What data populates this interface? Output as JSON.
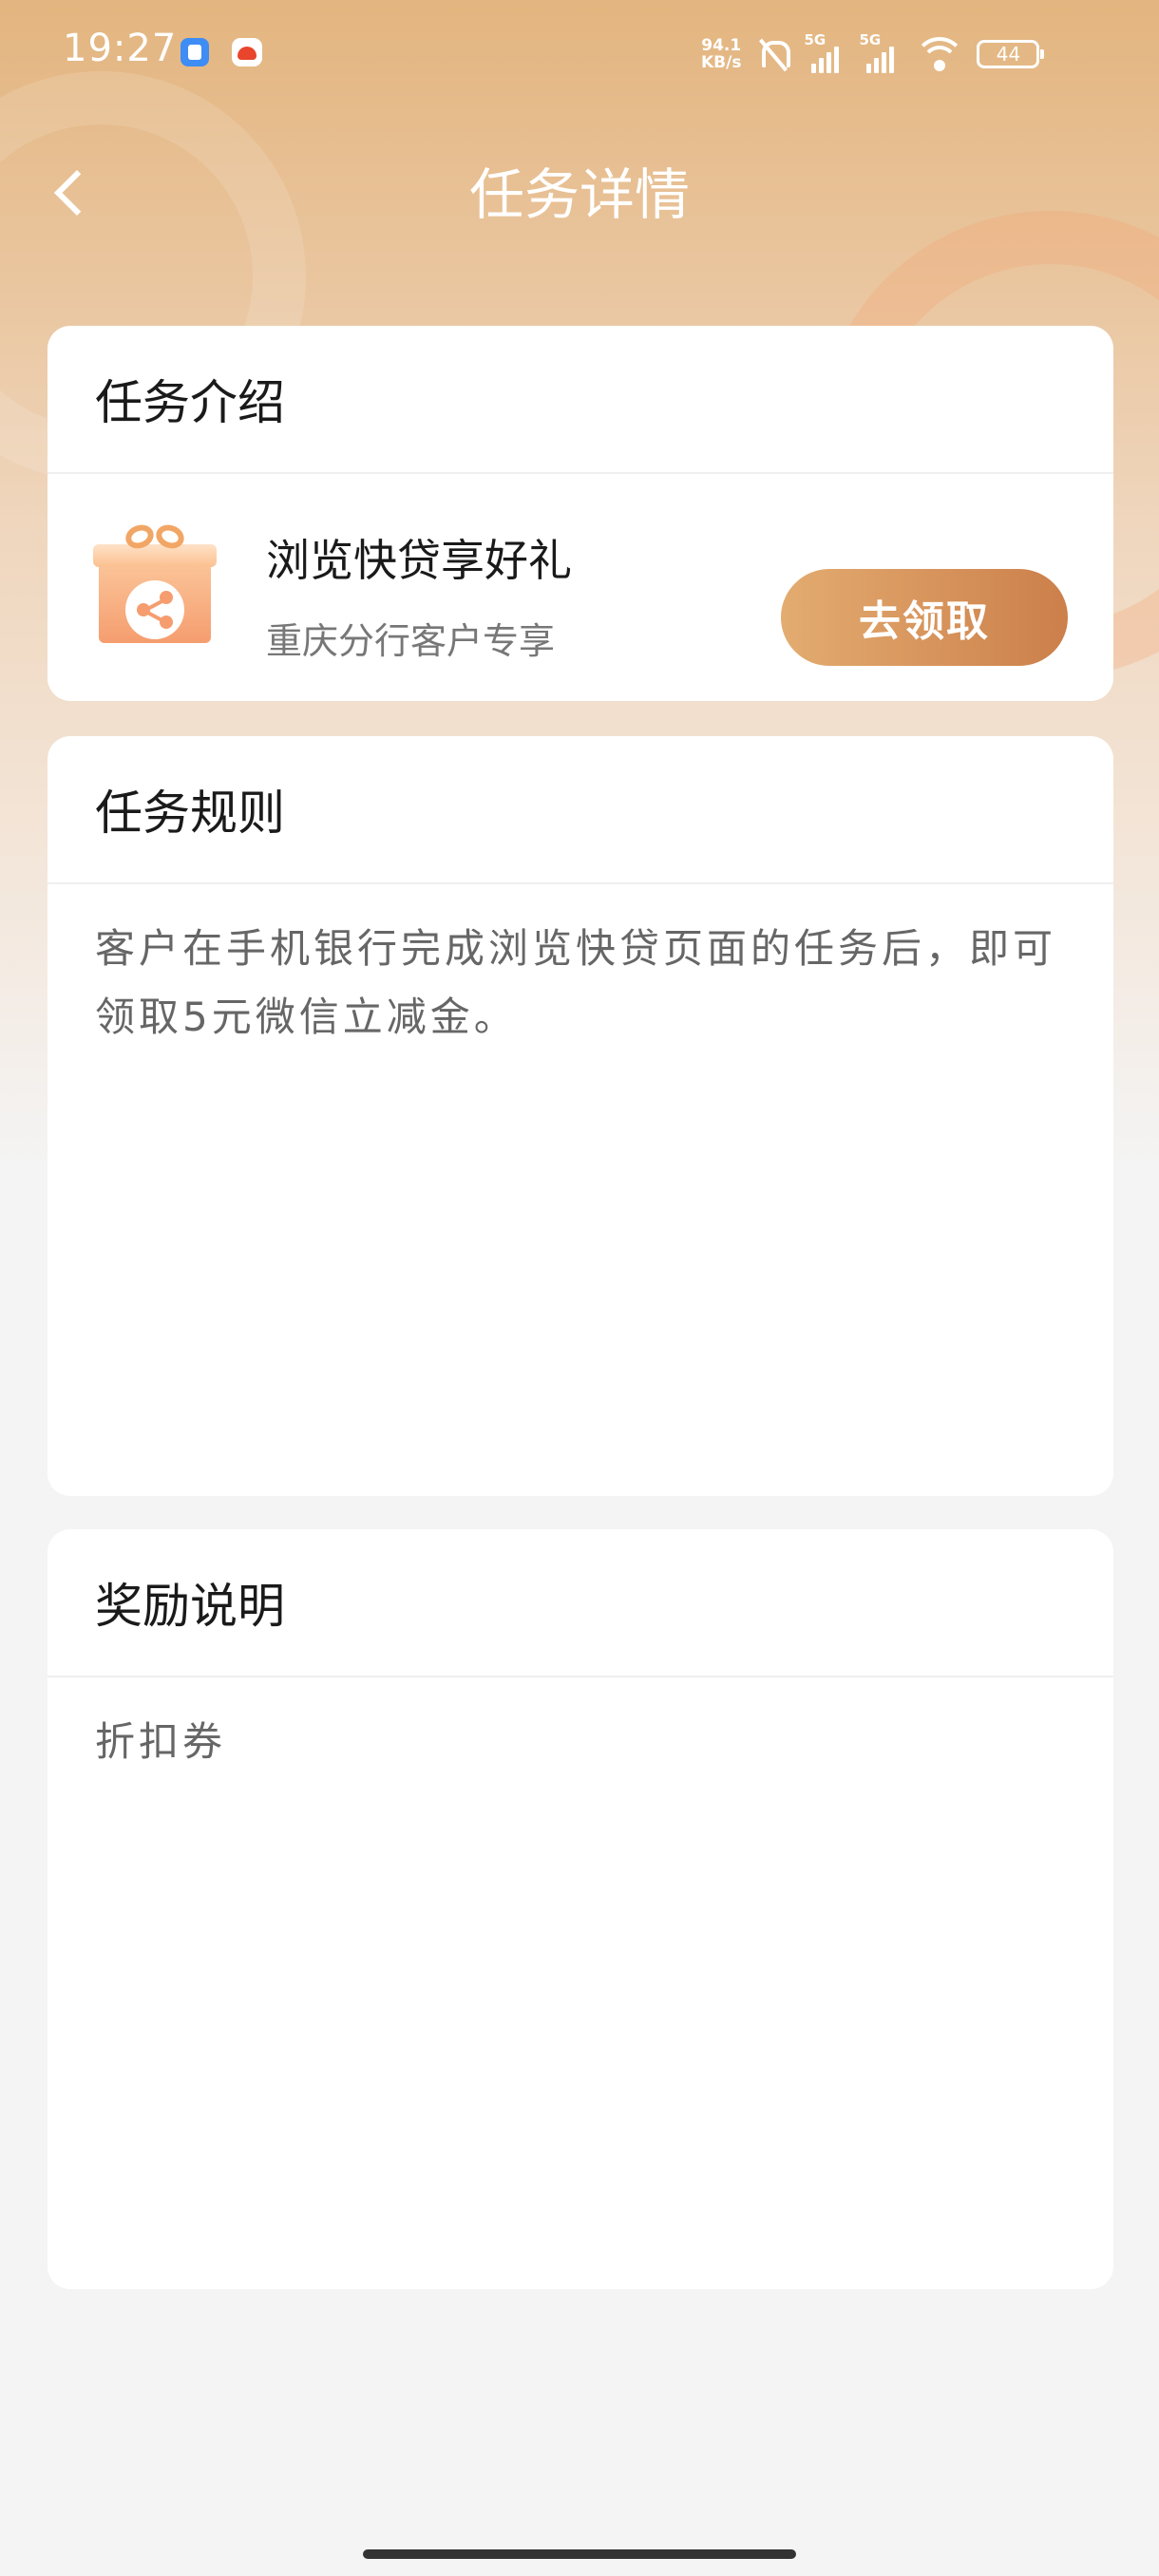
{
  "status_bar": {
    "time": "19:27",
    "net_speed_value": "94.1",
    "net_speed_unit": "KB/s",
    "signal1_label": "5G",
    "signal2_label": "5G",
    "battery": "44",
    "icons": [
      "app-notification-icon",
      "app-notification-icon-2",
      "mute-icon",
      "signal-icon",
      "wifi-icon",
      "battery-icon"
    ]
  },
  "header": {
    "title": "任务详情",
    "back_icon": "chevron-left-icon"
  },
  "task_intro": {
    "header": "任务介绍",
    "task_title": "浏览快贷享好礼",
    "task_subtitle": "重庆分行客户专享",
    "icon": "gift-share-icon",
    "button_label": "去领取"
  },
  "task_rules": {
    "header": "任务规则",
    "body": "客户在手机银行完成浏览快贷页面的任务后，即可领取5元微信立减金。"
  },
  "reward_info": {
    "header": "奖励说明",
    "body": "折扣券"
  },
  "colors": {
    "accent_gradient_start": "#e3ac70",
    "accent_gradient_end": "#cc7f4a",
    "header_bg": "#e3b57f"
  }
}
